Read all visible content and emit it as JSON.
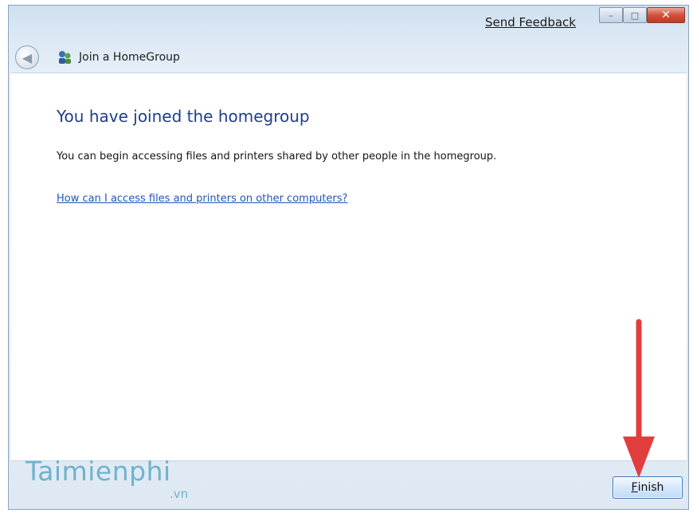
{
  "titlebar": {
    "send_feedback": "Send Feedback",
    "minimize": "–",
    "maximize": "□",
    "close": "✕"
  },
  "nav": {
    "back_glyph": "◀",
    "title": "Join a HomeGroup",
    "icon": "homegroup-icon"
  },
  "main": {
    "heading": "You have joined the homegroup",
    "body": "You can begin accessing files and printers shared by other people in the homegroup.",
    "link": "How can I access files and printers on other computers?"
  },
  "footer": {
    "finish_underlined": "F",
    "finish_rest": "inish"
  },
  "watermark": {
    "brand": "Taimienphi",
    "suffix": ".vn"
  },
  "colors": {
    "heading": "#1e3e8c",
    "link": "#1f56b8",
    "annotation_arrow": "#e23d3d",
    "watermark": "#6fb3cc"
  }
}
